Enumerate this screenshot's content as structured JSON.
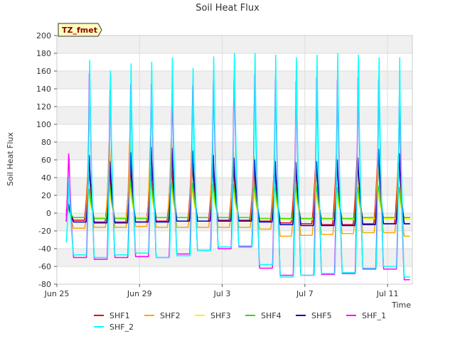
{
  "chart_data": {
    "type": "line",
    "title": "Soil Heat Flux",
    "xlabel": "Time",
    "ylabel": "Soil Heat Flux",
    "site_tag": "TZ_fmet",
    "xlim": [
      0,
      17.2
    ],
    "ylim": [
      -80,
      200
    ],
    "y_ticks": [
      -80,
      -60,
      -40,
      -20,
      0,
      20,
      40,
      60,
      80,
      100,
      120,
      140,
      160,
      180,
      200
    ],
    "x_ticks": [
      {
        "day": 0,
        "label": "Jun 25"
      },
      {
        "day": 4,
        "label": "Jun 29"
      },
      {
        "day": 8,
        "label": "Jul 3"
      },
      {
        "day": 12,
        "label": "Jul 7"
      },
      {
        "day": 16,
        "label": "Jul 11"
      }
    ],
    "grid": true,
    "background_bands": true,
    "legend_position": "bottom",
    "series": [
      {
        "name": "SHF1",
        "color": "#e0001b",
        "night": [
          -8,
          -8,
          -10,
          -10,
          -10,
          -9,
          -9,
          -9,
          -8,
          -8,
          -9,
          -11,
          -12,
          -13,
          -13,
          -12,
          -12,
          -12
        ],
        "peak": [
          12,
          60,
          55,
          60,
          58,
          62,
          65,
          60,
          60,
          55,
          58,
          60,
          62,
          65,
          67,
          68,
          64,
          65
        ]
      },
      {
        "name": "SHF2",
        "color": "#ffa500",
        "night": [
          -12,
          -17,
          -16,
          -16,
          -15,
          -16,
          -16,
          -16,
          -16,
          -16,
          -18,
          -26,
          -25,
          -24,
          -23,
          -22,
          -22,
          -26
        ],
        "peak": [
          15,
          72,
          87,
          93,
          95,
          90,
          85,
          81,
          77,
          72,
          72,
          68,
          65,
          65,
          66,
          73,
          72,
          63
        ]
      },
      {
        "name": "SHF3",
        "color": "#ffef00",
        "night": [
          -5,
          -5,
          -5,
          -5,
          -5,
          -5,
          -5,
          -5,
          -5,
          -5,
          -6,
          -7,
          -7,
          -7,
          -7,
          -6,
          -6,
          -6
        ],
        "peak": [
          6,
          22,
          26,
          28,
          28,
          27,
          26,
          25,
          24,
          23,
          23,
          22,
          22,
          22,
          22,
          24,
          23,
          20
        ]
      },
      {
        "name": "SHF4",
        "color": "#33dd00",
        "night": [
          -3,
          -5,
          -6,
          -6,
          -6,
          -5,
          -5,
          -5,
          -5,
          -5,
          -6,
          -6,
          -6,
          -6,
          -6,
          -5,
          -5,
          -5
        ],
        "peak": [
          5,
          30,
          35,
          40,
          40,
          38,
          37,
          36,
          35,
          34,
          34,
          33,
          33,
          32,
          32,
          34,
          32,
          28
        ]
      },
      {
        "name": "SHF5",
        "color": "#0000c0",
        "night": [
          -5,
          -10,
          -11,
          -11,
          -10,
          -10,
          -9,
          -9,
          -9,
          -9,
          -10,
          -13,
          -14,
          -14,
          -14,
          -13,
          -12,
          -12
        ],
        "peak": [
          10,
          65,
          58,
          68,
          74,
          73,
          70,
          65,
          62,
          60,
          58,
          57,
          58,
          60,
          62,
          72,
          67,
          58
        ]
      },
      {
        "name": "SHF_1",
        "color": "#ff00ff",
        "night": [
          -15,
          -50,
          -52,
          -50,
          -49,
          -50,
          -46,
          -42,
          -40,
          -38,
          -62,
          -70,
          -70,
          -69,
          -68,
          -63,
          -63,
          -75
        ],
        "peak": [
          75,
          178,
          158,
          165,
          165,
          153,
          163,
          168,
          170,
          175,
          172,
          170,
          175,
          172,
          175,
          172,
          150,
          170
        ]
      },
      {
        "name": "SHF_2",
        "color": "#00ffff",
        "night": [
          -33,
          -47,
          -50,
          -47,
          -45,
          -50,
          -48,
          -42,
          -38,
          -37,
          -58,
          -72,
          -70,
          -68,
          -67,
          -62,
          -60,
          -72
        ],
        "peak": [
          40,
          172,
          160,
          168,
          170,
          175,
          163,
          176,
          180,
          180,
          178,
          175,
          178,
          180,
          178,
          175,
          175,
          173
        ]
      }
    ]
  }
}
